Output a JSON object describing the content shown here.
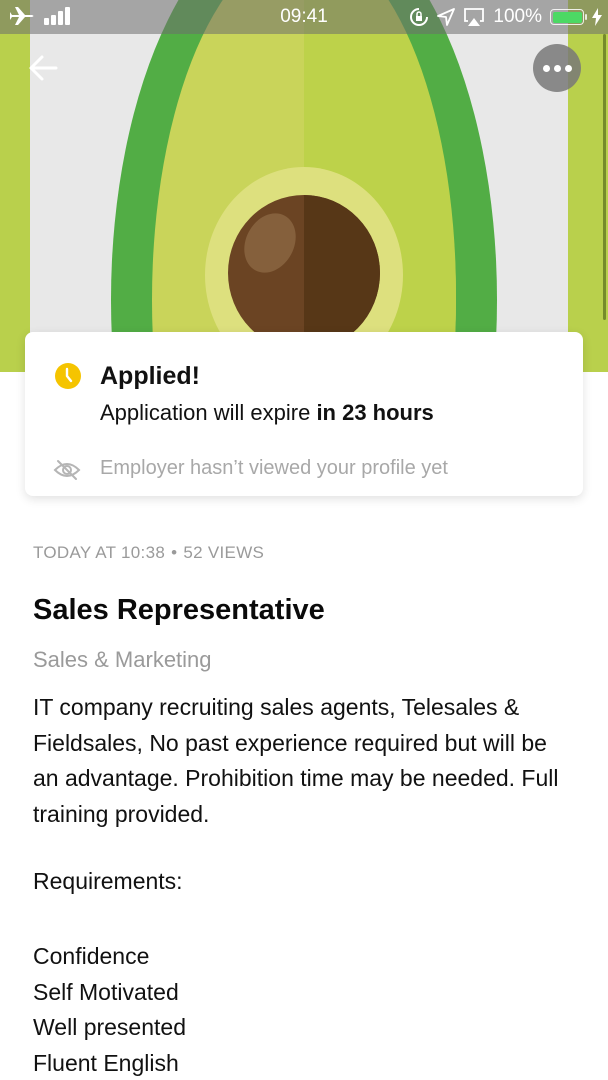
{
  "status_bar": {
    "time": "09:41",
    "battery_percent": "100%",
    "battery_level": 1.0,
    "icons": [
      "airplane-icon",
      "signal-icon",
      "rotation-lock-icon",
      "location-icon",
      "airplay-icon",
      "battery-icon",
      "charging-icon"
    ]
  },
  "hero": {
    "image": "avocado-illustration",
    "back_icon": "arrow-left-icon",
    "more_icon": "more-horizontal-icon"
  },
  "application_status": {
    "icon": "clock-icon",
    "title": "Applied!",
    "expire_prefix": "Application will expire ",
    "expire_value": "in 23 hours",
    "view_icon": "eye-off-icon",
    "view_note": "Employer hasn’t viewed your profile yet",
    "accent_color": "#f5c400"
  },
  "job": {
    "posted": "TODAY AT 10:38",
    "separator": "•",
    "views": "52 VIEWS",
    "title": "Sales Representative",
    "category": "Sales & Marketing",
    "description": "IT company recruiting sales agents, Telesales & Fieldsales, No past experience required but will be an advantage. Prohibition time may be needed. Full training provided.",
    "requirements_label": "Requirements:",
    "requirements": [
      "Confidence",
      "Self Motivated",
      "Well presented",
      "Fluent English"
    ]
  }
}
